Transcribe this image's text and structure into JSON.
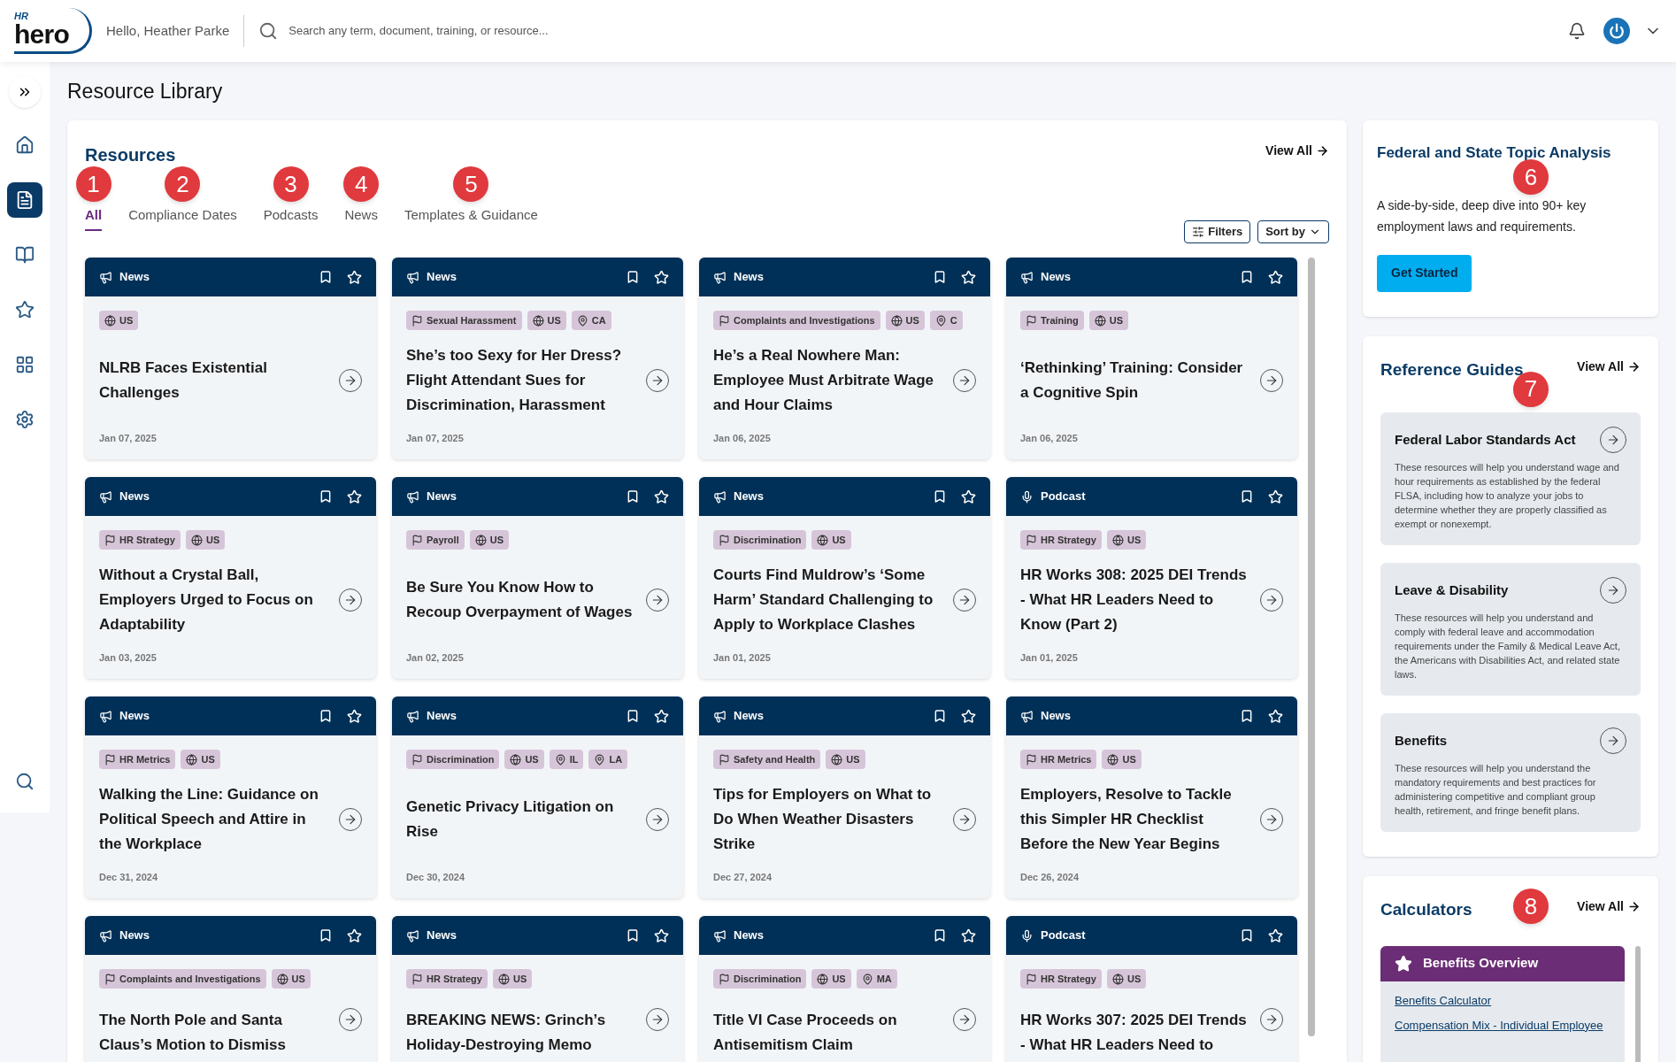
{
  "header": {
    "logo_small": "HR",
    "logo": "hero",
    "greeting": "Hello, Heather Parke",
    "search_placeholder": "Search any term, document, training, or resource..."
  },
  "sidebar": [
    {
      "kind": "home",
      "selected": false
    },
    {
      "kind": "document",
      "selected": true
    },
    {
      "kind": "book",
      "selected": false
    },
    {
      "kind": "star",
      "selected": false
    },
    {
      "kind": "grid",
      "selected": false
    },
    {
      "kind": "gear",
      "selected": false
    }
  ],
  "page_title": "Resource Library",
  "resources": {
    "title": "Resources",
    "view_all": "View All",
    "filters": "Filters",
    "sort": "Sort by",
    "tabs": [
      {
        "label": "All",
        "selected": true,
        "marker": "1"
      },
      {
        "label": "Compliance Dates",
        "selected": false,
        "marker": "2"
      },
      {
        "label": "Podcasts",
        "selected": false,
        "marker": "3"
      },
      {
        "label": "News",
        "selected": false,
        "marker": "4"
      },
      {
        "label": "Templates & Guidance",
        "selected": false,
        "marker": "5"
      }
    ],
    "cards": [
      {
        "kind": "news",
        "type": "News",
        "tags": [
          {
            "kind": "country",
            "label": "US"
          }
        ],
        "title": "NLRB Faces Existential Challenges",
        "date": "Jan 07, 2025"
      },
      {
        "kind": "news",
        "type": "News",
        "tags": [
          {
            "kind": "topic",
            "label": "Sexual Harassment"
          },
          {
            "kind": "country",
            "label": "US"
          },
          {
            "kind": "state",
            "label": "CA"
          }
        ],
        "title": "She’s too Sexy for Her Dress? Flight Attendant Sues for Discrimination, Harassment",
        "date": "Jan 07, 2025"
      },
      {
        "kind": "news",
        "type": "News",
        "tags": [
          {
            "kind": "topic",
            "label": "Complaints and Investigations"
          },
          {
            "kind": "country",
            "label": "US"
          },
          {
            "kind": "state",
            "label": "C"
          }
        ],
        "title": "He’s a Real Nowhere Man: Employee Must Arbitrate Wage and Hour Claims",
        "date": "Jan 06, 2025"
      },
      {
        "kind": "news",
        "type": "News",
        "tags": [
          {
            "kind": "topic",
            "label": "Training"
          },
          {
            "kind": "country",
            "label": "US"
          }
        ],
        "title": "‘Rethinking’ Training: Consider a Cognitive Spin",
        "date": "Jan 06, 2025"
      },
      {
        "kind": "news",
        "type": "News",
        "tags": [
          {
            "kind": "topic",
            "label": "HR Strategy"
          },
          {
            "kind": "country",
            "label": "US"
          }
        ],
        "title": "Without a Crystal Ball, Employers Urged to Focus on Adaptability",
        "date": "Jan 03, 2025"
      },
      {
        "kind": "news",
        "type": "News",
        "tags": [
          {
            "kind": "topic",
            "label": "Payroll"
          },
          {
            "kind": "country",
            "label": "US"
          }
        ],
        "title": "Be Sure You Know How to Recoup Overpayment of Wages",
        "date": "Jan 02, 2025"
      },
      {
        "kind": "news",
        "type": "News",
        "tags": [
          {
            "kind": "topic",
            "label": "Discrimination"
          },
          {
            "kind": "country",
            "label": "US"
          }
        ],
        "title": "Courts Find Muldrow’s ‘Some Harm’ Standard Challenging to Apply to Workplace Clashes",
        "date": "Jan 01, 2025"
      },
      {
        "kind": "podcast",
        "type": "Podcast",
        "tags": [
          {
            "kind": "topic",
            "label": "HR Strategy"
          },
          {
            "kind": "country",
            "label": "US"
          }
        ],
        "title": "HR Works 308: 2025 DEI Trends - What HR Leaders Need to Know (Part 2)",
        "date": "Jan 01, 2025"
      },
      {
        "kind": "news",
        "type": "News",
        "tags": [
          {
            "kind": "topic",
            "label": "HR Metrics"
          },
          {
            "kind": "country",
            "label": "US"
          }
        ],
        "title": "Walking the Line: Guidance on Political Speech and Attire in the Workplace",
        "date": "Dec 31, 2024"
      },
      {
        "kind": "news",
        "type": "News",
        "tags": [
          {
            "kind": "topic",
            "label": "Discrimination"
          },
          {
            "kind": "country",
            "label": "US"
          },
          {
            "kind": "state",
            "label": "IL"
          },
          {
            "kind": "state",
            "label": "LA"
          }
        ],
        "title": "Genetic Privacy Litigation on Rise",
        "date": "Dec 30, 2024"
      },
      {
        "kind": "news",
        "type": "News",
        "tags": [
          {
            "kind": "topic",
            "label": "Safety and Health"
          },
          {
            "kind": "country",
            "label": "US"
          }
        ],
        "title": "Tips for Employers on What to Do When Weather Disasters Strike",
        "date": "Dec 27, 2024"
      },
      {
        "kind": "news",
        "type": "News",
        "tags": [
          {
            "kind": "topic",
            "label": "HR Metrics"
          },
          {
            "kind": "country",
            "label": "US"
          }
        ],
        "title": "Employers, Resolve to Tackle this Simpler HR Checklist Before the New Year Begins",
        "date": "Dec 26, 2024"
      },
      {
        "kind": "news",
        "type": "News",
        "tags": [
          {
            "kind": "topic",
            "label": "Complaints and Investigations"
          },
          {
            "kind": "country",
            "label": "US"
          }
        ],
        "title": "The North Pole and Santa Claus’s Motion to Dismiss"
      },
      {
        "kind": "news",
        "type": "News",
        "tags": [
          {
            "kind": "topic",
            "label": "HR Strategy"
          },
          {
            "kind": "country",
            "label": "US"
          }
        ],
        "title": "BREAKING NEWS: Grinch’s Holiday-Destroying Memo"
      },
      {
        "kind": "news",
        "type": "News",
        "tags": [
          {
            "kind": "topic",
            "label": "Discrimination"
          },
          {
            "kind": "country",
            "label": "US"
          },
          {
            "kind": "state",
            "label": "MA"
          }
        ],
        "title": "Title VI Case Proceeds on Antisemitism Claim"
      },
      {
        "kind": "podcast",
        "type": "Podcast",
        "tags": [
          {
            "kind": "topic",
            "label": "HR Strategy"
          },
          {
            "kind": "country",
            "label": "US"
          }
        ],
        "title": "HR Works 307: 2025 DEI Trends - What HR Leaders Need to"
      }
    ]
  },
  "topic_analysis": {
    "title": "Federal and State Topic Analysis",
    "marker": "6",
    "text": "A side-by-side, deep dive into 90+ key employment laws and requirements.",
    "button": "Get Started"
  },
  "reference_guides": {
    "title": "Reference Guides",
    "marker": "7",
    "view_all": "View All",
    "items": [
      {
        "title": "Federal Labor Standards Act",
        "text": "These resources will help you understand wage and hour requirements as established by the federal FLSA, including how to analyze your jobs to determine whether they are properly classified as exempt or nonexempt."
      },
      {
        "title": "Leave & Disability",
        "text": "These resources will help you understand and comply with federal leave and accommodation requirements under the Family & Medical Leave Act, the Americans with Disabilities Act, and related state laws."
      },
      {
        "title": "Benefits",
        "text": "These resources will help you understand the mandatory requirements and best practices for administering competitive and compliant group health, retirement, and fringe benefit plans."
      }
    ]
  },
  "calculators": {
    "title": "Calculators",
    "marker": "8",
    "view_all": "View All",
    "group": "Benefits Overview",
    "links": [
      "Benefits Calculator",
      "Compensation Mix - Individual Employee"
    ]
  }
}
